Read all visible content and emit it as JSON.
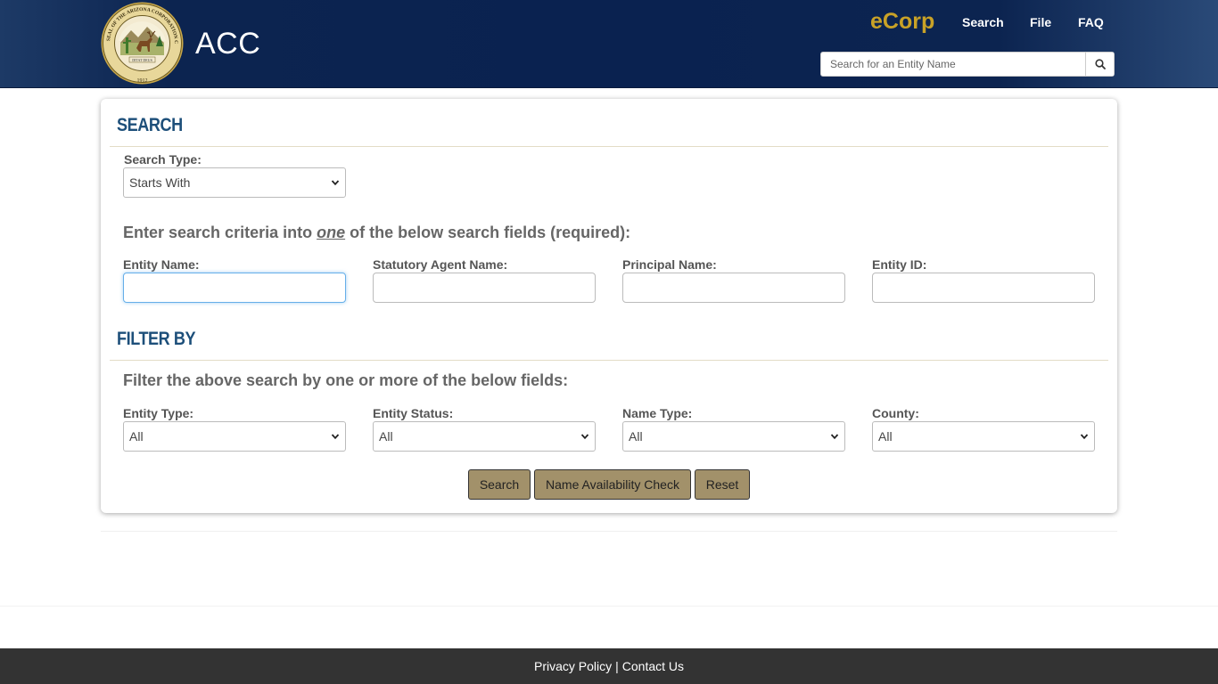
{
  "header": {
    "seal_alt": "Seal of the Arizona Corporation Commission",
    "seal_text_top": "SEAL OF THE ARIZONA CORPORATION COMMISSION",
    "seal_motto": "DITAT DEUS",
    "seal_year": "1912",
    "brand": "ACC",
    "ecorp": "eCorp",
    "nav": {
      "search": "Search",
      "file": "File",
      "faq": "FAQ"
    },
    "entity_search_placeholder": "Search for an Entity Name"
  },
  "search": {
    "title": "SEARCH",
    "search_type_label": "Search Type:",
    "search_type_value": "Starts With",
    "instruction_pre": "Enter search criteria into ",
    "instruction_em": "one",
    "instruction_post": " of the below search fields (required):",
    "fields": {
      "entity_name": "Entity Name:",
      "statutory_agent": "Statutory Agent Name:",
      "principal_name": "Principal Name:",
      "entity_id": "Entity ID:"
    }
  },
  "filter": {
    "title": "FILTER BY",
    "instruction": "Filter the above search by one or more of the below fields:",
    "entity_type_label": "Entity Type:",
    "entity_type_value": "All",
    "entity_status_label": "Entity Status:",
    "entity_status_value": "All",
    "name_type_label": "Name Type:",
    "name_type_value": "All",
    "county_label": "County:",
    "county_value": "All"
  },
  "buttons": {
    "search": "Search",
    "name_availability": "Name Availability Check",
    "reset": "Reset"
  },
  "footer": {
    "privacy": "Privacy Policy",
    "separator": "|",
    "contact": "Contact Us"
  },
  "colors": {
    "header_bg": "#0a2250",
    "ecorp_gold": "#c9a227",
    "section_title": "#1d4f7a",
    "button_gold": "#a2916a",
    "footer_bg": "#333333"
  },
  "icons": {
    "search": "search-icon",
    "chevron": "chevron-down-icon"
  }
}
